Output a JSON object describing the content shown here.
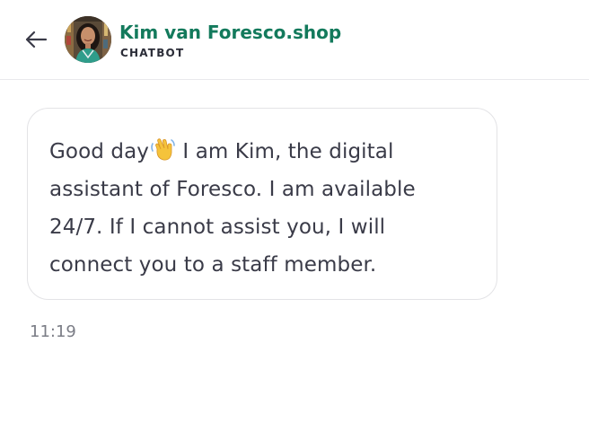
{
  "header": {
    "back_icon": "arrow-left-icon",
    "avatar_alt": "Kim",
    "title": "Kim van Foresco.shop",
    "subtitle": "CHATBOT",
    "title_color": "#137a5c"
  },
  "message": {
    "lines": [
      "Good day",
      " I am Kim, the digital",
      "assistant of Foresco. I am available",
      "24/7. If I cannot assist you, I will",
      "connect you to a staff member."
    ],
    "emoji": "waving-hand-icon",
    "time": "11:19"
  }
}
